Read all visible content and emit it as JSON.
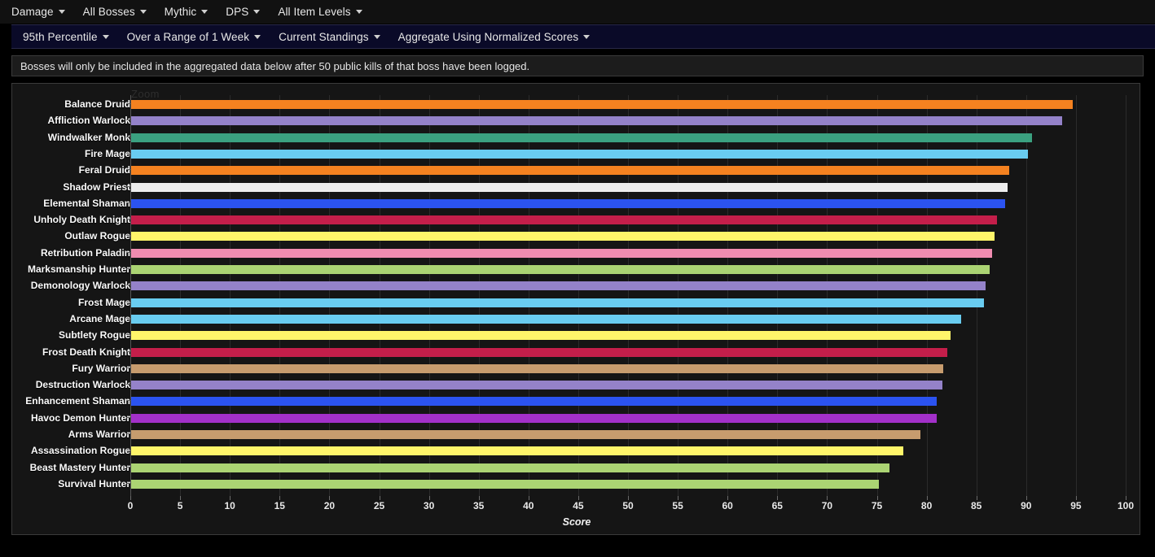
{
  "nav_primary": [
    {
      "label": "Damage",
      "name": "nav-damage"
    },
    {
      "label": "All Bosses",
      "name": "nav-all-bosses"
    },
    {
      "label": "Mythic",
      "name": "nav-mythic"
    },
    {
      "label": "DPS",
      "name": "nav-dps"
    },
    {
      "label": "All Item Levels",
      "name": "nav-all-item-levels"
    }
  ],
  "nav_secondary": [
    {
      "label": "95th Percentile",
      "name": "nav-percentile"
    },
    {
      "label": "Over a Range of 1 Week",
      "name": "nav-range"
    },
    {
      "label": "Current Standings",
      "name": "nav-standings"
    },
    {
      "label": "Aggregate Using Normalized Scores",
      "name": "nav-aggregate"
    }
  ],
  "notice": "Bosses will only be included in the aggregated data below after 50 public kills of that boss have been logged.",
  "zoom_label": "Zoom",
  "chart_data": {
    "type": "bar",
    "orientation": "horizontal",
    "title": "",
    "xlabel": "Score",
    "ylabel": "",
    "xlim": [
      0,
      100
    ],
    "xticks": [
      0,
      5,
      10,
      15,
      20,
      25,
      30,
      35,
      40,
      45,
      50,
      55,
      60,
      65,
      70,
      75,
      80,
      85,
      90,
      95,
      100
    ],
    "grid": true,
    "legend": "none",
    "categories": [
      "Balance Druid",
      "Affliction Warlock",
      "Windwalker Monk",
      "Fire Mage",
      "Feral Druid",
      "Shadow Priest",
      "Elemental Shaman",
      "Unholy Death Knight",
      "Outlaw Rogue",
      "Retribution Paladin",
      "Marksmanship Hunter",
      "Demonology Warlock",
      "Frost Mage",
      "Arcane Mage",
      "Subtlety Rogue",
      "Frost Death Knight",
      "Fury Warrior",
      "Destruction Warlock",
      "Enhancement Shaman",
      "Havoc Demon Hunter",
      "Arms Warrior",
      "Assassination Rogue",
      "Beast Mastery Hunter",
      "Survival Hunter"
    ],
    "values": [
      94.7,
      93.6,
      90.6,
      90.2,
      88.3,
      88.1,
      87.9,
      87.1,
      86.8,
      86.6,
      86.3,
      85.9,
      85.8,
      83.5,
      82.4,
      82.1,
      81.7,
      81.6,
      81.0,
      81.0,
      79.4,
      77.7,
      76.3,
      75.2
    ],
    "colors": [
      "#f58220",
      "#9482c9",
      "#3ba180",
      "#69ccf0",
      "#f58220",
      "#eeeeee",
      "#2b53f0",
      "#c41e4a",
      "#fff56a",
      "#f08cb0",
      "#abd473",
      "#9482c9",
      "#69ccf0",
      "#69ccf0",
      "#fff56a",
      "#c41e4a",
      "#c79c6e",
      "#9482c9",
      "#2b53f0",
      "#a330c9",
      "#c79c6e",
      "#fff56a",
      "#abd473",
      "#abd473"
    ]
  }
}
